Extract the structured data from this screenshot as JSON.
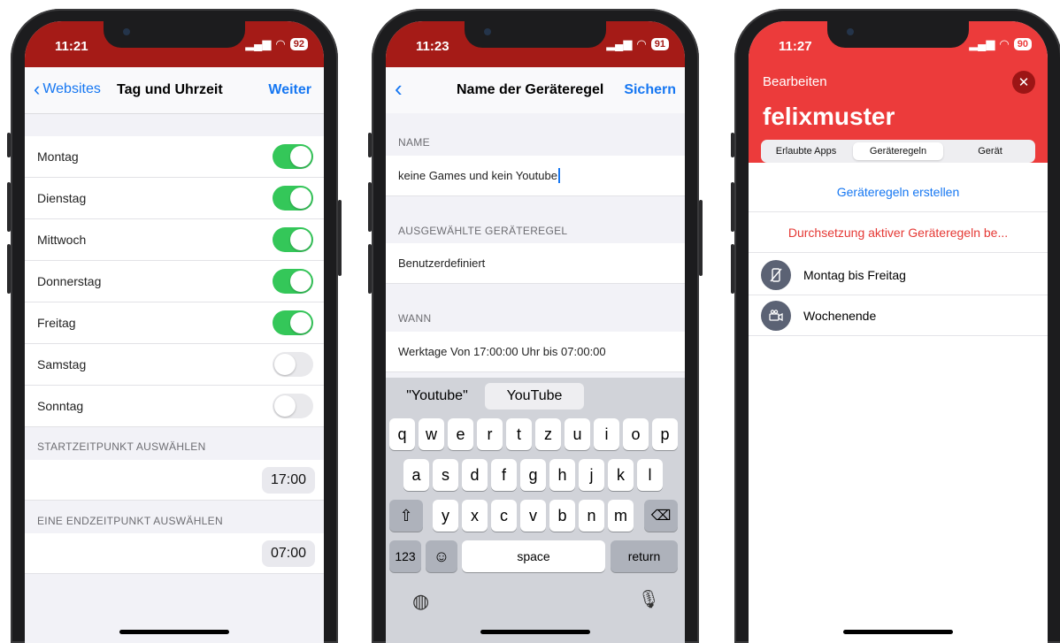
{
  "phone1": {
    "status": {
      "time": "11:21",
      "battery": "92"
    },
    "nav": {
      "back_label": "Websites",
      "title": "Tag und Uhrzeit",
      "next_label": "Weiter"
    },
    "days": [
      {
        "label": "Montag",
        "on": true
      },
      {
        "label": "Dienstag",
        "on": true
      },
      {
        "label": "Mittwoch",
        "on": true
      },
      {
        "label": "Donnerstag",
        "on": true
      },
      {
        "label": "Freitag",
        "on": true
      },
      {
        "label": "Samstag",
        "on": false
      },
      {
        "label": "Sonntag",
        "on": false
      }
    ],
    "start_section": "STARTZEITPUNKT AUSWÄHLEN",
    "start_time": "17:00",
    "end_section": "EINE ENDZEITPUNKT AUSWÄHLEN",
    "end_time": "07:00"
  },
  "phone2": {
    "status": {
      "time": "11:23",
      "battery": "91"
    },
    "nav": {
      "title": "Name der Geräteregel",
      "save_label": "Sichern"
    },
    "name_section": "NAME",
    "name_value": "keine Games und kein Youtube",
    "rule_section": "AUSGEWÄHLTE GERÄTEREGEL",
    "rule_value": "Benutzerdefiniert",
    "when_section": "WANN",
    "when_value": "Werktage Von 17:00:00 Uhr bis 07:00:00",
    "keyboard": {
      "suggestions": [
        "\"Youtube\"",
        "YouTube"
      ],
      "row1": [
        "q",
        "w",
        "e",
        "r",
        "t",
        "z",
        "u",
        "i",
        "o",
        "p"
      ],
      "row2": [
        "a",
        "s",
        "d",
        "f",
        "g",
        "h",
        "j",
        "k",
        "l"
      ],
      "row3": [
        "y",
        "x",
        "c",
        "v",
        "b",
        "n",
        "m"
      ],
      "shift_icon": "shift-icon",
      "delete_icon": "backspace-icon",
      "numbers_label": "123",
      "emoji_icon": "emoji-icon",
      "space_label": "space",
      "return_label": "return",
      "globe_icon": "globe-icon",
      "mic_icon": "microphone-icon"
    }
  },
  "phone3": {
    "status": {
      "time": "11:27",
      "battery": "90"
    },
    "edit_label": "Bearbeiten",
    "username": "felixmuster",
    "tabs": [
      {
        "label": "Erlaubte Apps",
        "selected": false
      },
      {
        "label": "Geräteregeln",
        "selected": true
      },
      {
        "label": "Gerät",
        "selected": false
      }
    ],
    "create_rule": "Geräteregeln erstellen",
    "enforce_rules": "Durchsetzung aktiver Geräteregeln be...",
    "rules": [
      {
        "label": "Montag bis Freitag",
        "icon": "phone-disabled-icon"
      },
      {
        "label": "Wochenende",
        "icon": "camera-people-icon"
      }
    ],
    "colors": {
      "header": "#ec3b3b",
      "link": "#1677f2",
      "danger": "#e53935"
    }
  }
}
